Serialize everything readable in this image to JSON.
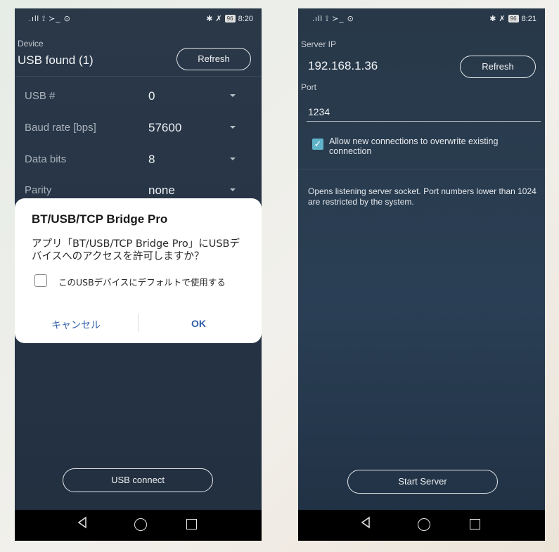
{
  "status_left": {
    "signal_text": ".ıll ⟟ ≻_ ⊙",
    "time": "8:20",
    "battery": "96"
  },
  "status_right": {
    "signal_text": ".ıll ⟟ ≻_ ⊙",
    "time": "8:21",
    "battery": "96"
  },
  "left_screen": {
    "device_label": "Device",
    "device_status": "USB found (1)",
    "refresh_label": "Refresh",
    "settings": [
      {
        "label": "USB #",
        "value": "0"
      },
      {
        "label": "Baud rate [bps]",
        "value": "57600"
      },
      {
        "label": "Data bits",
        "value": "8"
      },
      {
        "label": "Parity",
        "value": "none"
      }
    ],
    "connect_label": "USB connect"
  },
  "dialog": {
    "title": "BT/USB/TCP Bridge Pro",
    "message": "アプリ「BT/USB/TCP Bridge Pro」にUSBデバイスへのアクセスを許可しますか？",
    "checkbox_label": "このUSBデバイスにデフォルトで使用する",
    "cancel_label": "キャンセル",
    "ok_label": "OK"
  },
  "right_screen": {
    "server_ip_label": "Server IP",
    "server_ip": "192.168.1.36",
    "refresh_label": "Refresh",
    "port_label": "Port",
    "port_value": "1234",
    "overwrite_label": "Allow new connections to overwrite existing connection",
    "overwrite_checked": true,
    "description": "Opens listening server socket. Port numbers lower than 1024 are restricted by the system.",
    "start_label": "Start Server"
  },
  "icons": [
    "bluetooth-icon",
    "mute-icon",
    "back-icon",
    "home-icon",
    "recent-apps-icon",
    "caret-down-icon",
    "checkmark-icon"
  ],
  "colors": {
    "accent_checkbox": "#5fb3c9",
    "dialog_button": "#2f5eaa"
  }
}
